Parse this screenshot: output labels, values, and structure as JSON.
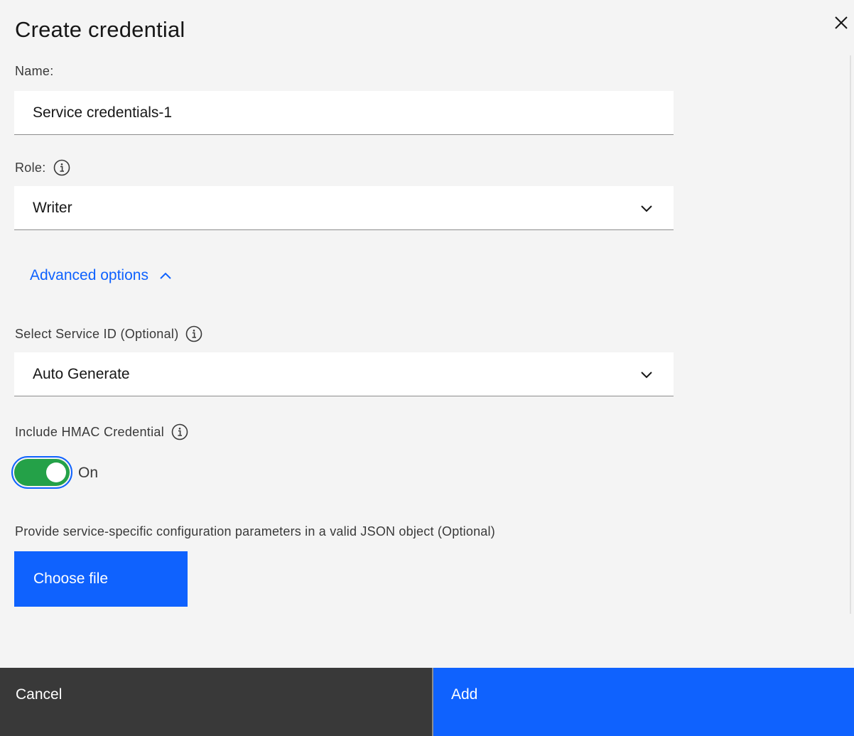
{
  "modal": {
    "title": "Create credential"
  },
  "form": {
    "name": {
      "label": "Name:",
      "value": "Service credentials-1"
    },
    "role": {
      "label": "Role:",
      "value": "Writer"
    },
    "advanced_label": "Advanced options",
    "service_id": {
      "label": "Select Service ID (Optional)",
      "value": "Auto Generate"
    },
    "hmac": {
      "label": "Include HMAC Credential",
      "state_text": "On",
      "enabled": true
    },
    "config_desc": "Provide service-specific configuration parameters in a valid JSON object (Optional)",
    "choose_file": "Choose file"
  },
  "footer": {
    "cancel": "Cancel",
    "add": "Add"
  },
  "colors": {
    "accent": "#0f62fe",
    "toggle_on": "#24a148",
    "background": "#f4f4f4",
    "cancel_bg": "#393939"
  }
}
